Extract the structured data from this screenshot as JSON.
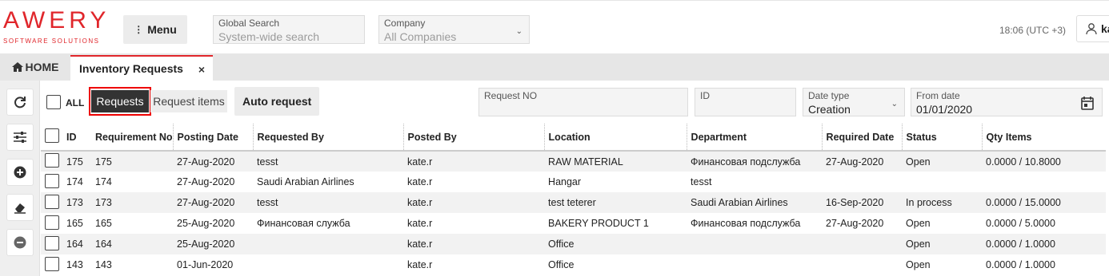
{
  "brand": {
    "name": "AWERY",
    "tagline": "SOFTWARE SOLUTIONS",
    "accent": "#e0262b"
  },
  "header": {
    "menu_label": "Menu",
    "global_search": {
      "label": "Global Search",
      "placeholder": "System-wide search"
    },
    "company": {
      "label": "Company",
      "value": "All Companies"
    },
    "time": "18:06 (UTC +3)",
    "user_initial": "ka"
  },
  "tabs": {
    "home": "HOME",
    "active": "Inventory Requests",
    "close": "×"
  },
  "toolbar": {
    "all_label": "ALL",
    "requests_label": "Requests",
    "request_items_label": "Request items",
    "auto_request_label": "Auto request",
    "filters": {
      "request_no": {
        "label": "Request NO",
        "value": ""
      },
      "id": {
        "label": "ID",
        "value": ""
      },
      "date_type": {
        "label": "Date type",
        "value": "Creation"
      },
      "from_date": {
        "label": "From date",
        "value": "01/01/2020"
      }
    }
  },
  "table": {
    "columns": [
      "ID",
      "Requirement No",
      "Posting Date",
      "Requested By",
      "Posted By",
      "Location",
      "Department",
      "Required Date",
      "Status",
      "Qty Items"
    ],
    "rows": [
      [
        "175",
        "175",
        "27-Aug-2020",
        "tesst",
        "kate.r",
        "RAW MATERIAL",
        "Финансовая подслужба",
        "27-Aug-2020",
        "Open",
        "0.0000 / 10.8000"
      ],
      [
        "174",
        "174",
        "27-Aug-2020",
        "Saudi Arabian Airlines",
        "kate.r",
        "Hangar",
        "tesst",
        "",
        "",
        ""
      ],
      [
        "173",
        "173",
        "27-Aug-2020",
        "tesst",
        "kate.r",
        "test teterer",
        "Saudi Arabian Airlines",
        "16-Sep-2020",
        "In process",
        "0.0000 / 15.0000"
      ],
      [
        "165",
        "165",
        "25-Aug-2020",
        "Финансовая служба",
        "kate.r",
        "BAKERY PRODUCT 1",
        "Финансовая подслужба",
        "27-Aug-2020",
        "Open",
        "0.0000 / 5.0000"
      ],
      [
        "164",
        "164",
        "25-Aug-2020",
        "",
        "kate.r",
        "Office",
        "",
        "",
        "Open",
        "0.0000 / 1.0000"
      ],
      [
        "143",
        "143",
        "01-Jun-2020",
        "",
        "kate.r",
        "Office",
        "",
        "",
        "Open",
        "0.0000 / 1.0000"
      ]
    ]
  }
}
